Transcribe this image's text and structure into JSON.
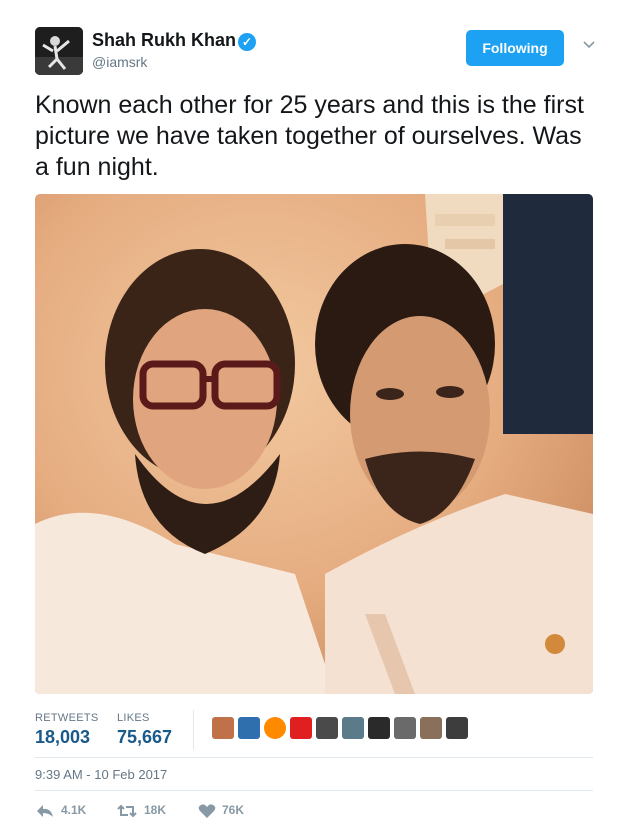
{
  "author": {
    "name": "Shah Rukh Khan",
    "handle": "@iamsrk",
    "verified_icon": "verified-badge-icon"
  },
  "follow_button": {
    "label": "Following"
  },
  "tweet": {
    "text": "Known each other for 25 years and this is the first picture we have taken together of ourselves. Was a fun night."
  },
  "stats": {
    "retweets_label": "RETWEETS",
    "retweets_count": "18,003",
    "likes_label": "LIKES",
    "likes_count": "75,667"
  },
  "timestamp": "9:39 AM - 10 Feb 2017",
  "actions": {
    "reply_count": "4.1K",
    "retweet_count": "18K",
    "like_count": "76K"
  },
  "colors": {
    "accent": "#1da1f2",
    "count_blue": "#1a5a8a",
    "muted": "#657786"
  }
}
